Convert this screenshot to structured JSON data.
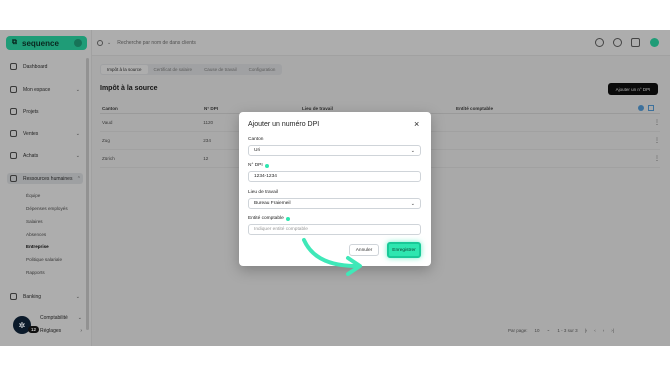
{
  "colors": {
    "accent": "#2ee6b0",
    "dark": "#111111",
    "overlay": "rgba(0,0,0,0.32)"
  },
  "app": {
    "name": "sequence"
  },
  "topbar": {
    "search_placeholder": "Recherche par nom de dans clients"
  },
  "sidebar": {
    "items": [
      {
        "label": "Dashboard",
        "icon": "home-icon"
      },
      {
        "label": "Mon espace",
        "icon": "user-icon"
      },
      {
        "label": "Projets",
        "icon": "check-square-icon"
      },
      {
        "label": "Ventes",
        "icon": "cart-icon"
      },
      {
        "label": "Achats",
        "icon": "bag-icon"
      },
      {
        "label": "Ressources humaines",
        "icon": "people-icon"
      },
      {
        "label": "Banking",
        "icon": "bank-icon"
      },
      {
        "label": "Comptabilité",
        "icon": "ledger-icon"
      },
      {
        "label": "Réglages",
        "icon": "gear-icon"
      }
    ],
    "subitems": [
      "Équipe",
      "Dépenses employés",
      "Salaires",
      "Absences",
      "Entreprise",
      "Politique salariale",
      "Rapports"
    ],
    "help_badge": "12"
  },
  "tabs": [
    "Impôt à la source",
    "Certificat de salaire",
    "Cause de travail",
    "Configuration"
  ],
  "page": {
    "title": "Impôt à la source",
    "add_button": "Ajouter un n° DPI"
  },
  "table": {
    "headers": [
      "Canton",
      "N° DPI",
      "Lieu de travail",
      "Entité comptable"
    ],
    "rows": [
      {
        "canton": "Vaud",
        "dpi": "1120"
      },
      {
        "canton": "Zug",
        "dpi": "234"
      },
      {
        "canton": "Zürich",
        "dpi": "12"
      }
    ]
  },
  "pager": {
    "per_page_label": "Par page:",
    "per_page": "10",
    "range": "1 - 3 sur 3"
  },
  "modal": {
    "title": "Ajouter un numéro DPI",
    "canton_label": "Canton",
    "canton_value": "Uri",
    "dpi_label": "N° DPI",
    "dpi_value": "1234-1234",
    "lieu_label": "Lieu de travail",
    "lieu_value": "Bureau Fraiemeil",
    "entite_label": "Entité comptable",
    "entite_placeholder": "Indiquer entité comptable",
    "cancel_label": "Annuler",
    "save_label": "Enregistrer"
  }
}
